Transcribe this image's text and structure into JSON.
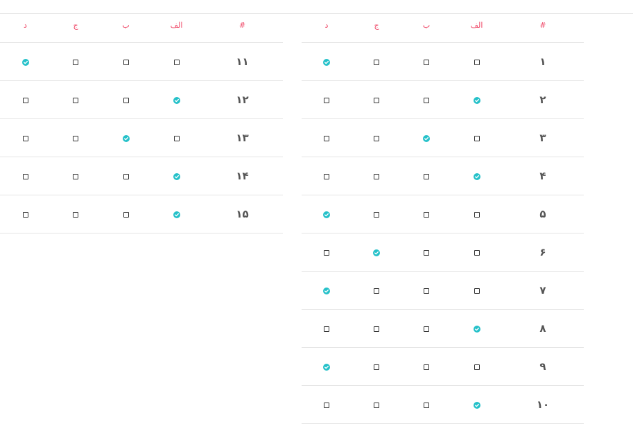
{
  "header": {
    "number": "#",
    "options": [
      "الف",
      "ب",
      "ج",
      "د"
    ]
  },
  "colors": {
    "header_text": "#ef4565",
    "selected": "#26c1c9",
    "number_text": "#555555"
  },
  "icons": {
    "selected": "check-circle-icon",
    "unselected": "checkbox-icon"
  },
  "tables": [
    {
      "rows": [
        {
          "number": "۱",
          "selected": 3
        },
        {
          "number": "۲",
          "selected": 0
        },
        {
          "number": "۳",
          "selected": 1
        },
        {
          "number": "۴",
          "selected": 0
        },
        {
          "number": "۵",
          "selected": 3
        },
        {
          "number": "۶",
          "selected": 2
        },
        {
          "number": "۷",
          "selected": 3
        },
        {
          "number": "۸",
          "selected": 0
        },
        {
          "number": "۹",
          "selected": 3
        },
        {
          "number": "۱۰",
          "selected": 0
        }
      ]
    },
    {
      "rows": [
        {
          "number": "۱۱",
          "selected": 3
        },
        {
          "number": "۱۲",
          "selected": 0
        },
        {
          "number": "۱۳",
          "selected": 1
        },
        {
          "number": "۱۴",
          "selected": 0
        },
        {
          "number": "۱۵",
          "selected": 0
        }
      ]
    }
  ]
}
